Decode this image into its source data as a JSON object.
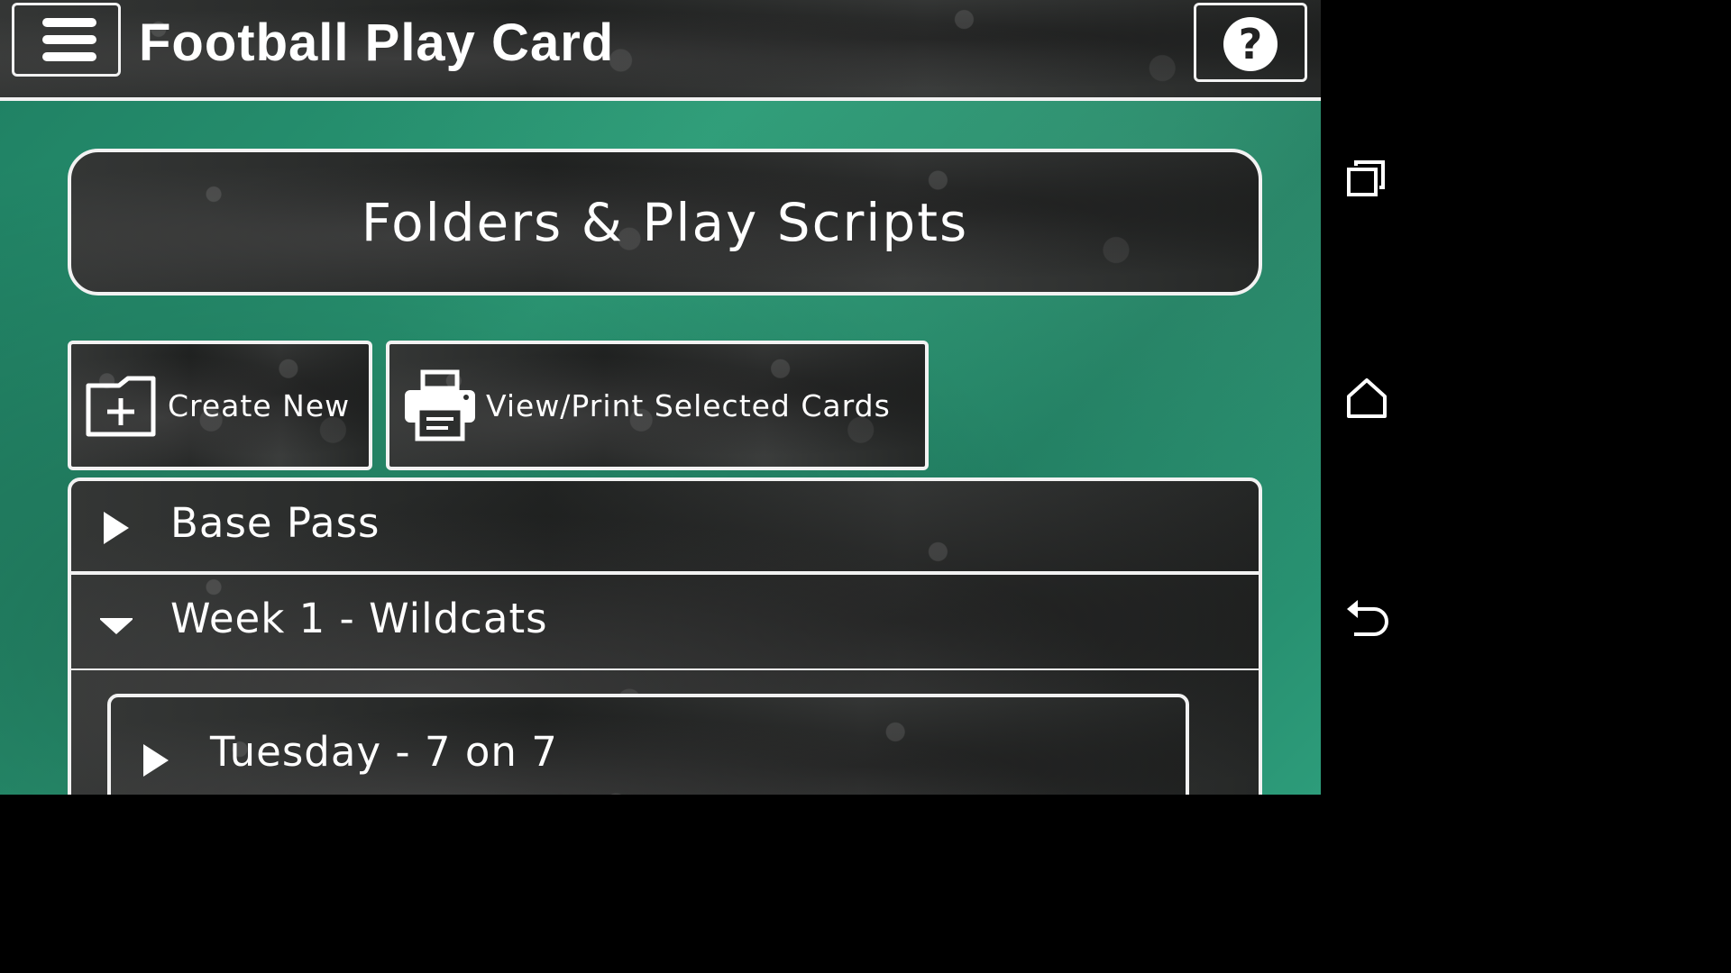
{
  "app": {
    "title": "Football Play Card",
    "menu_icon": "hamburger-menu-icon",
    "help_icon": "help-question-icon",
    "help_glyph": "?"
  },
  "section": {
    "title": "Folders & Play Scripts"
  },
  "actions": {
    "create_label": "Create New",
    "create_icon": "new-folder-icon",
    "print_label": "View/Print Selected Cards",
    "print_icon": "printer-icon"
  },
  "folders": [
    {
      "label": "Base Pass",
      "state": "collapsed",
      "arrow_icon": "expand-right-arrow-icon"
    },
    {
      "label": "Week 1 - Wildcats",
      "state": "expanded",
      "arrow_icon": "collapse-down-arrow-icon",
      "children": [
        {
          "label": "Tuesday - 7 on 7",
          "state": "collapsed",
          "arrow_icon": "expand-right-arrow-icon"
        }
      ]
    }
  ],
  "system_nav": {
    "recents_icon": "recent-apps-icon",
    "home_icon": "home-icon",
    "back_icon": "back-icon"
  },
  "colors": {
    "background_green": "#229474",
    "panel_dark": "#2c2e2d",
    "border_white": "#f2f2f2",
    "text": "#ffffff"
  }
}
